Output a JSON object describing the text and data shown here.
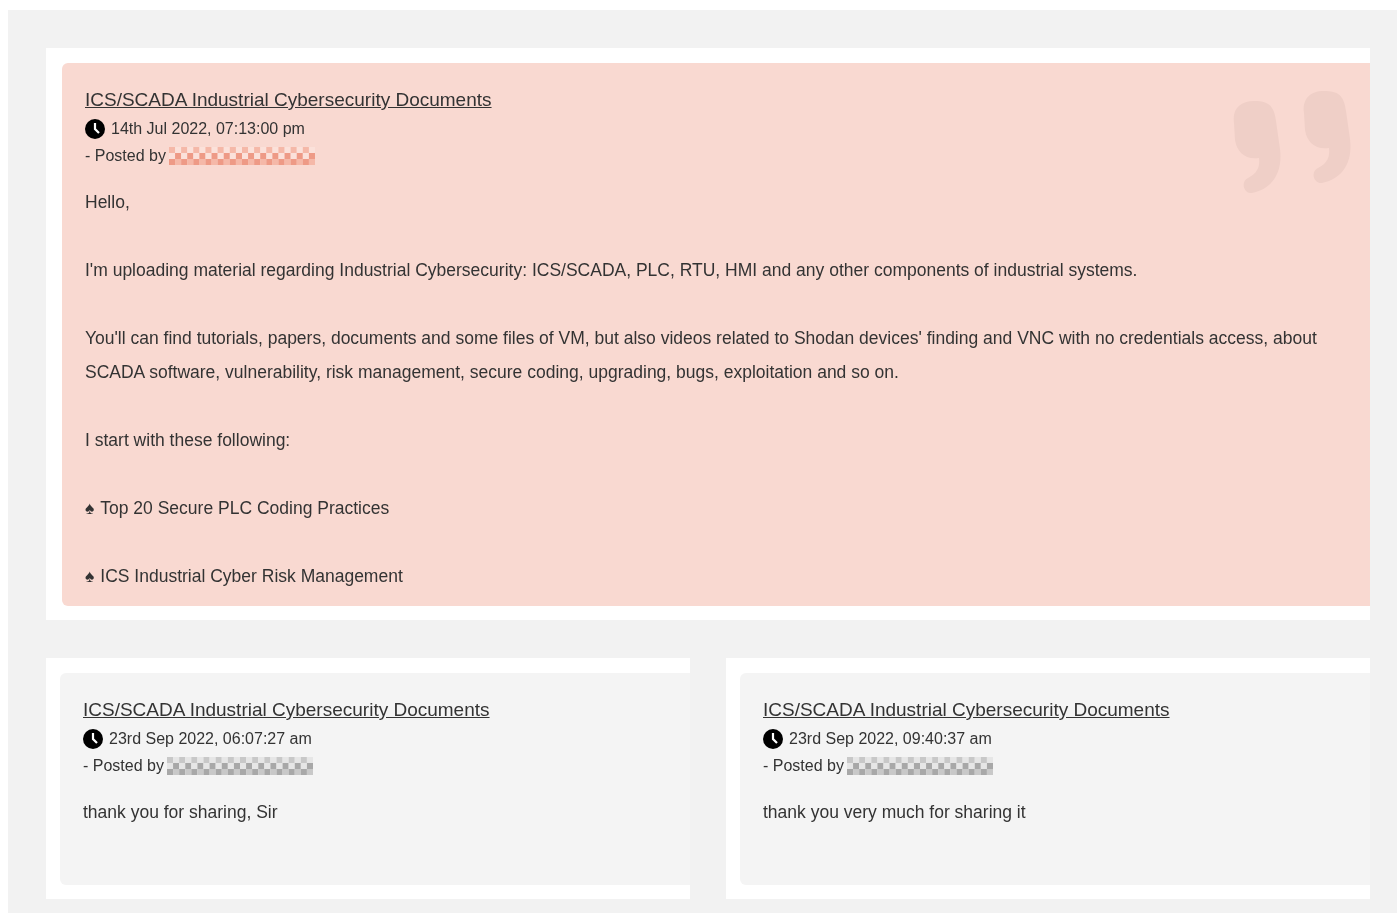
{
  "posts": [
    {
      "highlighted": true,
      "title": "ICS/SCADA Industrial Cybersecurity Documents",
      "time": "14th Jul 2022, 07:13:00 pm",
      "posted_by": "- Posted by",
      "body": [
        {
          "kind": "text",
          "text": "Hello,"
        },
        {
          "kind": "text",
          "text": "I'm uploading material regarding Industrial Cybersecurity: ICS/SCADA, PLC, RTU, HMI and any other components of industrial systems."
        },
        {
          "kind": "text",
          "text": "You'll can find tutorials, papers, documents and some files of VM, but also videos related to Shodan devices' finding and VNC with no credentials access, about SCADA software, vulnerability, risk management, secure coding, upgrading, bugs, exploitation and so on."
        },
        {
          "kind": "text",
          "text": "I start with these following:"
        },
        {
          "kind": "bullet",
          "marker": "♠",
          "text": "Top 20 Secure PLC Coding Practices"
        },
        {
          "kind": "bullet",
          "marker": "♠",
          "text": "ICS Industrial Cyber Risk Management"
        }
      ]
    }
  ],
  "replies": [
    {
      "highlighted": false,
      "title": "ICS/SCADA Industrial Cybersecurity Documents",
      "time": "23rd Sep 2022, 06:07:27 am",
      "posted_by": "- Posted by",
      "body": [
        {
          "kind": "text",
          "text": "thank you for sharing, Sir"
        }
      ]
    },
    {
      "highlighted": false,
      "title": "ICS/SCADA Industrial Cybersecurity Documents",
      "time": "23rd Sep 2022, 09:40:37 am",
      "posted_by": "- Posted by",
      "body": [
        {
          "kind": "text",
          "text": "thank you very much for sharing it"
        }
      ]
    }
  ]
}
